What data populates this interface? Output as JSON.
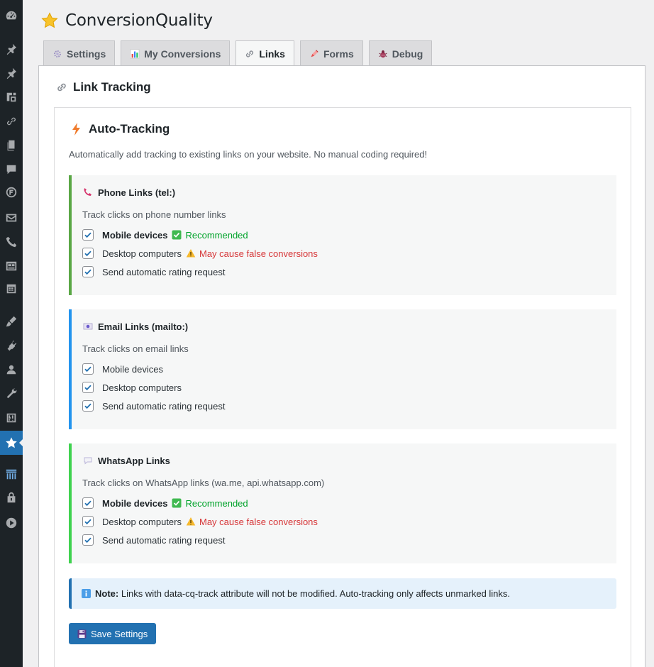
{
  "header": {
    "title": "ConversionQuality",
    "icon": "star-icon"
  },
  "tabs": [
    {
      "label": "Settings",
      "icon": "gear-icon",
      "active": false
    },
    {
      "label": "My Conversions",
      "icon": "bar-chart-icon",
      "active": false
    },
    {
      "label": "Links",
      "icon": "link-icon",
      "active": true
    },
    {
      "label": "Forms",
      "icon": "form-icon",
      "active": false
    },
    {
      "label": "Debug",
      "icon": "bug-icon",
      "active": false
    }
  ],
  "section": {
    "title": "Link Tracking"
  },
  "auto": {
    "title": "Auto-Tracking",
    "description": "Automatically add tracking to existing links on your website. No manual coding required!"
  },
  "groups": {
    "phone": {
      "title": "Phone Links (tel:)",
      "description": "Track clicks on phone number links",
      "mobile": {
        "label": "Mobile devices",
        "badge": "Recommended",
        "checked": true
      },
      "desktop": {
        "label": "Desktop computers",
        "badge": "May cause false conversions",
        "checked": true
      },
      "rating": {
        "label": "Send automatic rating request",
        "checked": true
      }
    },
    "email": {
      "title": "Email Links (mailto:)",
      "description": "Track clicks on email links",
      "mobile": {
        "label": "Mobile devices",
        "checked": true
      },
      "desktop": {
        "label": "Desktop computers",
        "checked": true
      },
      "rating": {
        "label": "Send automatic rating request",
        "checked": true
      }
    },
    "whatsapp": {
      "title": "WhatsApp Links",
      "description": "Track clicks on WhatsApp links (wa.me, api.whatsapp.com)",
      "mobile": {
        "label": "Mobile devices",
        "badge": "Recommended",
        "checked": true
      },
      "desktop": {
        "label": "Desktop computers",
        "badge": "May cause false conversions",
        "checked": true
      },
      "rating": {
        "label": "Send automatic rating request",
        "checked": true
      }
    }
  },
  "note": {
    "label": "Note:",
    "text": "Links with data-cq-track attribute will not be modified. Auto-tracking only affects unmarked links."
  },
  "save": {
    "label": "Save Settings"
  },
  "colors": {
    "primary": "#2271b1",
    "success": "#00a32a",
    "danger": "#d63638",
    "sidebar": "#1d2327"
  }
}
